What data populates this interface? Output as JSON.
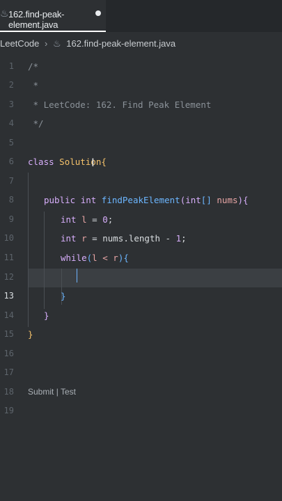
{
  "tab": {
    "icon": "java-file-icon",
    "title": "162.find-peak-element.java",
    "modified": true
  },
  "breadcrumb": {
    "root": "LeetCode",
    "file": "162.find-peak-element.java"
  },
  "lines": [
    "1",
    "2",
    "3",
    "4",
    "5",
    "6",
    "7",
    "8",
    "9",
    "10",
    "11",
    "12",
    "13",
    "14",
    "15",
    "16",
    "17",
    "18",
    "19"
  ],
  "active_line": "13",
  "code": {
    "l1": "/*",
    "l2": " *",
    "l3": " * LeetCode: 162. Find Peak Element",
    "l4": " */",
    "l7_kw": "class",
    "l7_name": "Solution",
    "l7_brace": "{",
    "l9_public": "public",
    "l9_int": "int",
    "l9_fn": "findPeakElement",
    "l9_open": "(",
    "l9_type": "int",
    "l9_arr": "[]",
    "l9_param": "nums",
    "l9_close": ")",
    "l9_brace": "{",
    "l10_kw": "int",
    "l10_var": "l",
    "l10_eq": " = ",
    "l10_num": "0",
    "l10_semi": ";",
    "l11_kw": "int",
    "l11_var": "r",
    "l11_eq": " = ",
    "l11_expr": "nums.length - ",
    "l11_num": "1",
    "l11_semi": ";",
    "l12_kw": "while",
    "l12_open": "(",
    "l12_cond": "l < r",
    "l12_close": ")",
    "l12_brace": "{",
    "l14": "}",
    "l15": "}",
    "l16": "}"
  },
  "codelens": {
    "submit": "Submit",
    "sep": " | ",
    "test": "Test"
  }
}
